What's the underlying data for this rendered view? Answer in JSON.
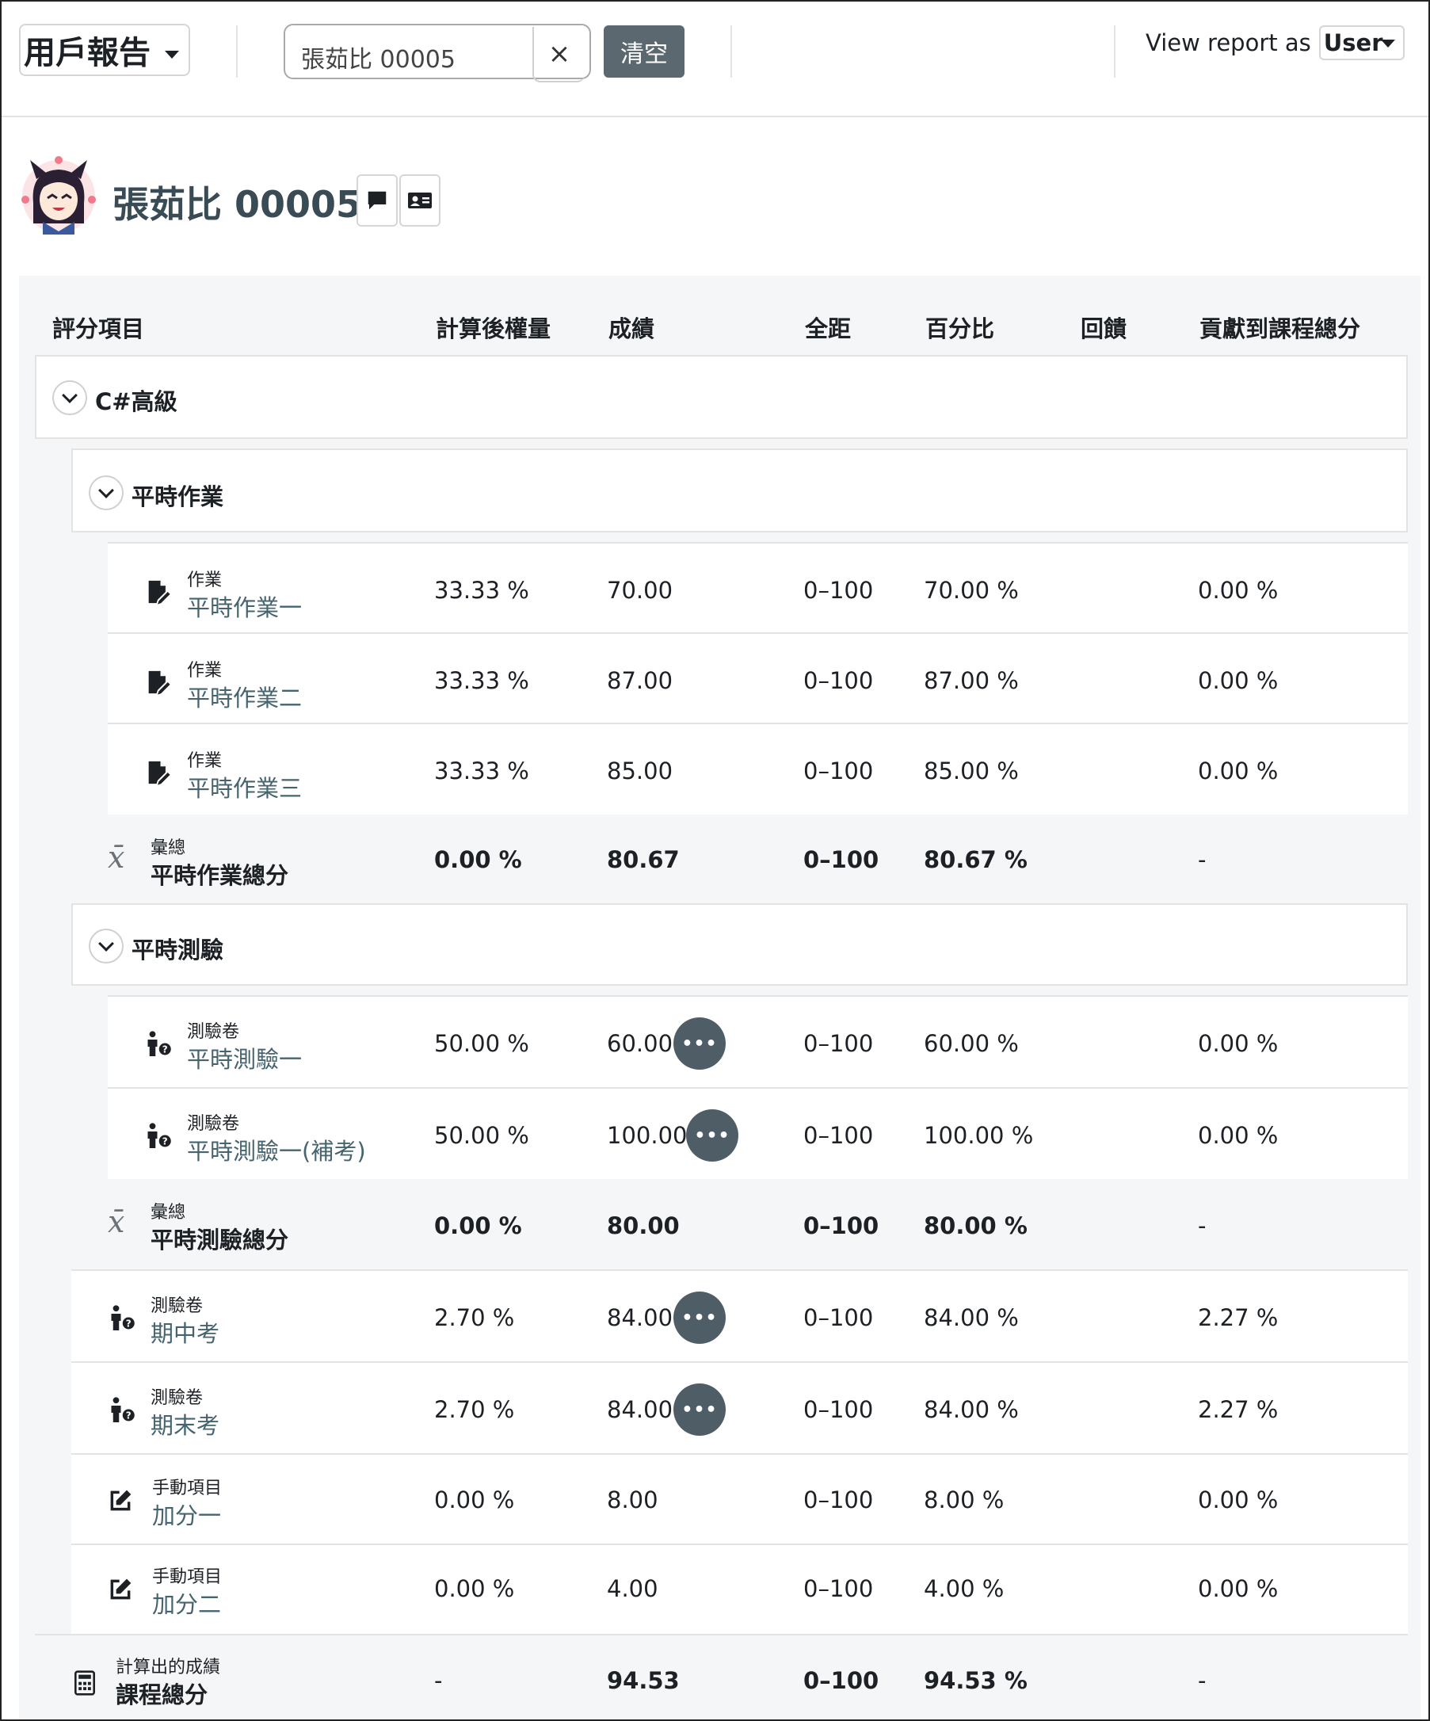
{
  "header": {
    "report_select": "用戶報告",
    "search_value": "張茹比 00005",
    "clear_x": "×",
    "clear_button": "清空",
    "view_report_as_label": "View report as",
    "view_report_as_value": "User"
  },
  "user": {
    "name": "張茹比 00005"
  },
  "columns": {
    "item": "評分項目",
    "weight": "計算後權量",
    "grade": "成績",
    "range": "全距",
    "percentage": "百分比",
    "feedback": "回饋",
    "contribution": "貢獻到課程總分"
  },
  "categories": {
    "course": "C#高級",
    "homework": "平時作業",
    "quiz": "平時測驗"
  },
  "homework_items": [
    {
      "type": "作業",
      "name": "平時作業一",
      "weight": "33.33 %",
      "grade": "70.00",
      "range": "0–100",
      "percentage": "70.00 %",
      "contribution": "0.00 %"
    },
    {
      "type": "作業",
      "name": "平時作業二",
      "weight": "33.33 %",
      "grade": "87.00",
      "range": "0–100",
      "percentage": "87.00 %",
      "contribution": "0.00 %"
    },
    {
      "type": "作業",
      "name": "平時作業三",
      "weight": "33.33 %",
      "grade": "85.00",
      "range": "0–100",
      "percentage": "85.00 %",
      "contribution": "0.00 %"
    }
  ],
  "homework_total": {
    "type": "彙總",
    "name": "平時作業總分",
    "weight": "0.00 %",
    "grade": "80.67",
    "range": "0–100",
    "percentage": "80.67 %",
    "contribution": "-"
  },
  "quiz_items": [
    {
      "type": "測驗卷",
      "name": "平時測驗一",
      "weight": "50.00 %",
      "grade": "60.00",
      "range": "0–100",
      "percentage": "60.00 %",
      "contribution": "0.00 %"
    },
    {
      "type": "測驗卷",
      "name": "平時測驗一(補考)",
      "weight": "50.00 %",
      "grade": "100.00",
      "range": "0–100",
      "percentage": "100.00 %",
      "contribution": "0.00 %"
    }
  ],
  "quiz_total": {
    "type": "彙總",
    "name": "平時測驗總分",
    "weight": "0.00 %",
    "grade": "80.00",
    "range": "0–100",
    "percentage": "80.00 %",
    "contribution": "-"
  },
  "course_items": [
    {
      "type": "測驗卷",
      "name": "期中考",
      "weight": "2.70 %",
      "grade": "84.00",
      "range": "0–100",
      "percentage": "84.00 %",
      "contribution": "2.27 %"
    },
    {
      "type": "測驗卷",
      "name": "期末考",
      "weight": "2.70 %",
      "grade": "84.00",
      "range": "0–100",
      "percentage": "84.00 %",
      "contribution": "2.27 %"
    },
    {
      "type": "手動項目",
      "name": "加分一",
      "weight": "0.00 %",
      "grade": "8.00",
      "range": "0–100",
      "percentage": "8.00 %",
      "contribution": "0.00 %"
    },
    {
      "type": "手動項目",
      "name": "加分二",
      "weight": "0.00 %",
      "grade": "4.00",
      "range": "0–100",
      "percentage": "4.00 %",
      "contribution": "0.00 %"
    }
  ],
  "course_total": {
    "type": "計算出的成績",
    "name": "課程總分",
    "weight": "-",
    "grade": "94.53",
    "range": "0–100",
    "percentage": "94.53 %",
    "contribution": "-"
  },
  "more_label": "•••",
  "icons": {
    "assignment": "assignment-icon",
    "quiz": "quiz-icon",
    "manual": "edit-icon",
    "aggregate": "mean-icon",
    "calculator": "calculator-icon",
    "message": "message-icon",
    "profile": "id-card-icon"
  },
  "colors": {
    "link": "#46646f",
    "button": "#5b6870",
    "more_button": "#4f5d66",
    "table_bg": "#f5f6f7"
  }
}
